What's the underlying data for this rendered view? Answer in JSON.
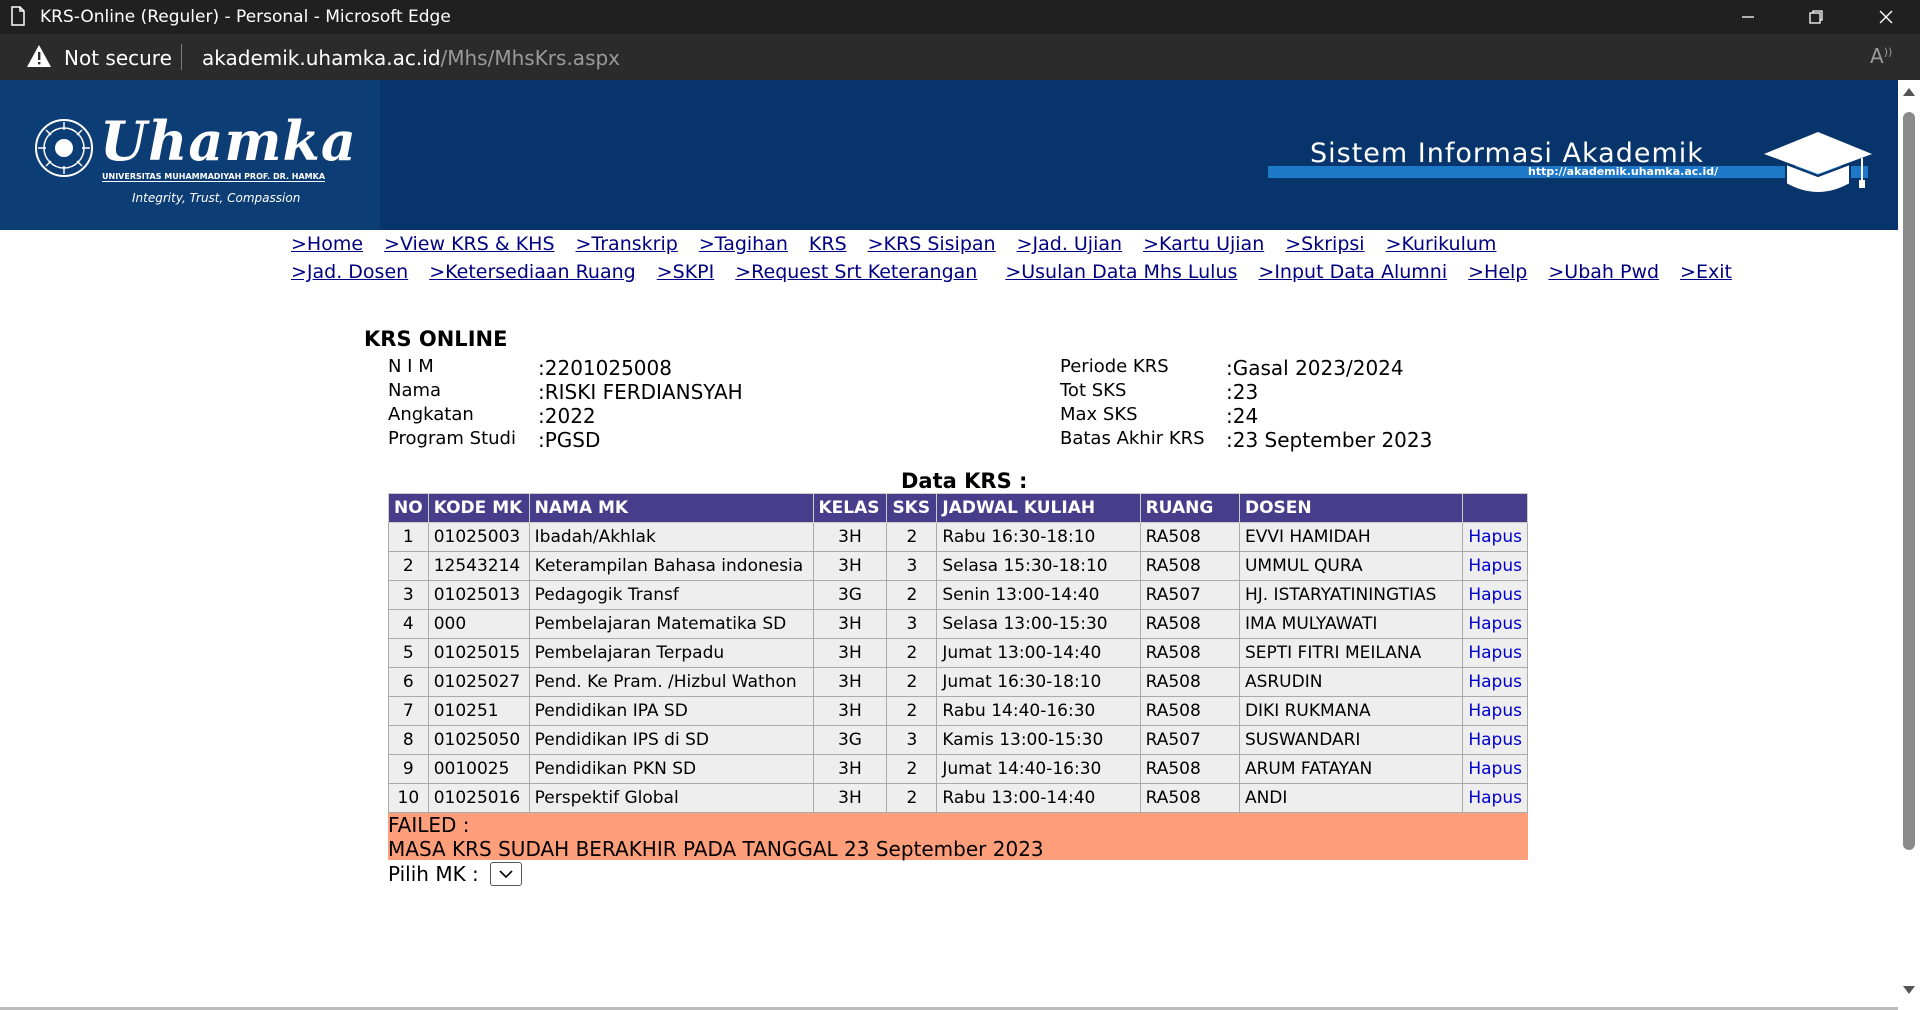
{
  "window": {
    "title": "KRS-Online (Reguler) - Personal - Microsoft Edge"
  },
  "address": {
    "security": "Not secure",
    "host": "akademik.uhamka.ac.id",
    "path": "/Mhs/MhsKrs.aspx"
  },
  "banner": {
    "brand": "Uhamka",
    "brand_sub": "UNIVERSITAS MUHAMMADIYAH PROF. DR. HAMKA",
    "motto": "Integrity, Trust, Compassion",
    "system_title": "Sistem Informasi Akademik",
    "system_url": "http://akademik.uhamka.ac.id/"
  },
  "nav": {
    "row1": [
      ">Home",
      ">View KRS & KHS",
      ">Transkrip",
      ">Tagihan",
      "KRS",
      ">KRS Sisipan",
      ">Jad. Ujian",
      ">Kartu Ujian",
      ">Skripsi",
      ">Kurikulum"
    ],
    "row2": [
      ">Jad. Dosen",
      ">Ketersediaan Ruang",
      ">SKPI",
      ">Request Srt Keterangan",
      ">Usulan Data Mhs Lulus",
      ">Input Data Alumni",
      ">Help",
      ">Ubah Pwd",
      ">Exit"
    ]
  },
  "krs": {
    "title": "KRS ONLINE",
    "left": [
      {
        "label": "N I M",
        "value": ":2201025008"
      },
      {
        "label": "Nama",
        "value": ":RISKI FERDIANSYAH"
      },
      {
        "label": "Angkatan",
        "value": ":2022"
      },
      {
        "label": "Program Studi",
        "value": ":PGSD"
      }
    ],
    "right": [
      {
        "label": "Periode KRS",
        "value": ":Gasal 2023/2024"
      },
      {
        "label": "Tot SKS",
        "value": ":23"
      },
      {
        "label": "Max SKS",
        "value": ":24"
      },
      {
        "label": "Batas Akhir KRS",
        "value": ":23 September 2023"
      }
    ],
    "data_title": "Data KRS :"
  },
  "table": {
    "headers": [
      "NO",
      "KODE MK",
      "NAMA MK",
      "KELAS",
      "SKS",
      "JADWAL KULIAH",
      "RUANG",
      "DOSEN",
      ""
    ],
    "rows": [
      {
        "no": "1",
        "kode": "01025003",
        "nama": "Ibadah/Akhlak",
        "kelas": "3H",
        "sks": "2",
        "jadwal": "Rabu 16:30-18:10",
        "ruang": "RA508",
        "dosen": "EVVI HAMIDAH",
        "action": "Hapus"
      },
      {
        "no": "2",
        "kode": "12543214",
        "nama": "Keterampilan Bahasa indonesia",
        "kelas": "3H",
        "sks": "3",
        "jadwal": "Selasa 15:30-18:10",
        "ruang": "RA508",
        "dosen": "UMMUL QURA",
        "action": "Hapus"
      },
      {
        "no": "3",
        "kode": "01025013",
        "nama": "Pedagogik Transf",
        "kelas": "3G",
        "sks": "2",
        "jadwal": "Senin 13:00-14:40",
        "ruang": "RA507",
        "dosen": "HJ. ISTARYATININGTIAS",
        "action": "Hapus"
      },
      {
        "no": "4",
        "kode": "000",
        "nama": "Pembelajaran Matematika SD",
        "kelas": "3H",
        "sks": "3",
        "jadwal": "Selasa 13:00-15:30",
        "ruang": "RA508",
        "dosen": "IMA MULYAWATI",
        "action": "Hapus"
      },
      {
        "no": "5",
        "kode": "01025015",
        "nama": "Pembelajaran Terpadu",
        "kelas": "3H",
        "sks": "2",
        "jadwal": "Jumat 13:00-14:40",
        "ruang": "RA508",
        "dosen": "SEPTI FITRI MEILANA",
        "action": "Hapus"
      },
      {
        "no": "6",
        "kode": "01025027",
        "nama": "Pend. Ke Pram. /Hizbul Wathon",
        "kelas": "3H",
        "sks": "2",
        "jadwal": "Jumat 16:30-18:10",
        "ruang": "RA508",
        "dosen": "ASRUDIN",
        "action": "Hapus"
      },
      {
        "no": "7",
        "kode": "010251",
        "nama": "Pendidikan IPA SD",
        "kelas": "3H",
        "sks": "2",
        "jadwal": "Rabu 14:40-16:30",
        "ruang": "RA508",
        "dosen": "DIKI RUKMANA",
        "action": "Hapus"
      },
      {
        "no": "8",
        "kode": "01025050",
        "nama": "Pendidikan IPS di SD",
        "kelas": "3G",
        "sks": "3",
        "jadwal": "Kamis 13:00-15:30",
        "ruang": "RA507",
        "dosen": "SUSWANDARI",
        "action": "Hapus"
      },
      {
        "no": "9",
        "kode": "0010025",
        "nama": "Pendidikan PKN SD",
        "kelas": "3H",
        "sks": "2",
        "jadwal": "Jumat 14:40-16:30",
        "ruang": "RA508",
        "dosen": "ARUM FATAYAN",
        "action": "Hapus"
      },
      {
        "no": "10",
        "kode": "01025016",
        "nama": "Perspektif Global",
        "kelas": "3H",
        "sks": "2",
        "jadwal": "Rabu 13:00-14:40",
        "ruang": "RA508",
        "dosen": "ANDI",
        "action": "Hapus"
      }
    ]
  },
  "message": {
    "status": "FAILED :",
    "text": "MASA KRS SUDAH BERAKHIR PADA TANGGAL 23 September 2023"
  },
  "pilih": {
    "label": "Pilih MK :"
  },
  "colors": {
    "banner": "#07346b",
    "table_header": "#483d8b",
    "error_bg": "#ff9e7a",
    "link": "#000080"
  }
}
